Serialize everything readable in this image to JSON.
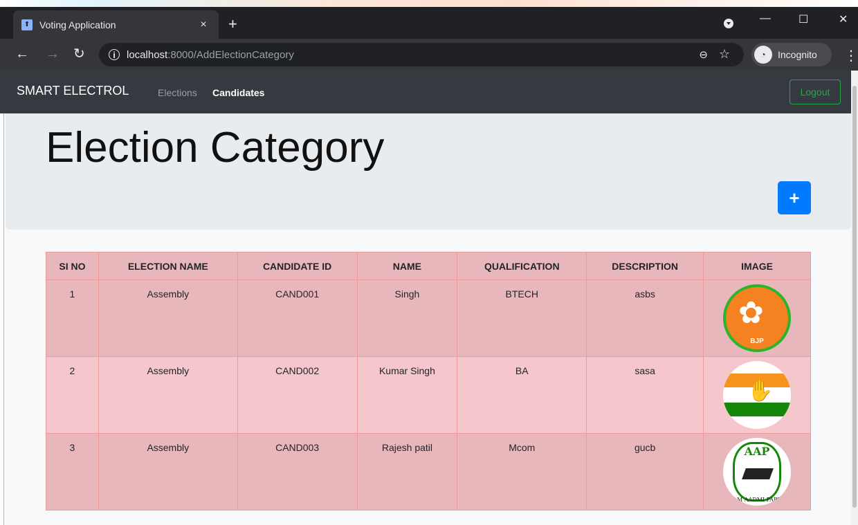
{
  "browser": {
    "tab_title": "Voting Application",
    "tab_close": "×",
    "new_tab": "+",
    "url_host": "localhost",
    "url_path": ":8000/AddElectionCategory",
    "profile_label": "Incognito",
    "win_min": "—",
    "win_max": "☐",
    "win_close": "✕"
  },
  "navbar": {
    "brand": "SMART ELECTROL",
    "links": [
      "Elections",
      "Candidates"
    ],
    "logout_label": "Logout"
  },
  "jumbotron": {
    "title": "Election Category",
    "add_button_label": "+"
  },
  "table": {
    "headers": [
      "SI NO",
      "ELECTION NAME",
      "CANDIDATE ID",
      "NAME",
      "QUALIFICATION",
      "DESCRIPTION",
      "IMAGE"
    ],
    "rows": [
      {
        "si_no": "1",
        "election_name": "Assembly",
        "candidate_id": "CAND001",
        "name": "Singh",
        "qualification": "BTECH",
        "description": "asbs",
        "image": "bjp-logo",
        "image_text": "BJP"
      },
      {
        "si_no": "2",
        "election_name": "Assembly",
        "candidate_id": "CAND002",
        "name": "Kumar Singh",
        "qualification": "BA",
        "description": "sasa",
        "image": "inc-hand-logo"
      },
      {
        "si_no": "3",
        "election_name": "Assembly",
        "candidate_id": "CAND003",
        "name": "Rajesh patil",
        "qualification": "Mcom",
        "description": "gucb",
        "image": "aap-broom-logo",
        "image_text_top": "AAP",
        "image_text_bottom": "AAM AADMI PARTY"
      }
    ]
  },
  "colors": {
    "navbar_bg": "#343a40",
    "jumbotron_bg": "#e9ecef",
    "add_button": "#007bff",
    "logout_border": "#28a745",
    "table_row_dark": "#e8b7bc",
    "table_row_light": "#f5c6cb"
  }
}
